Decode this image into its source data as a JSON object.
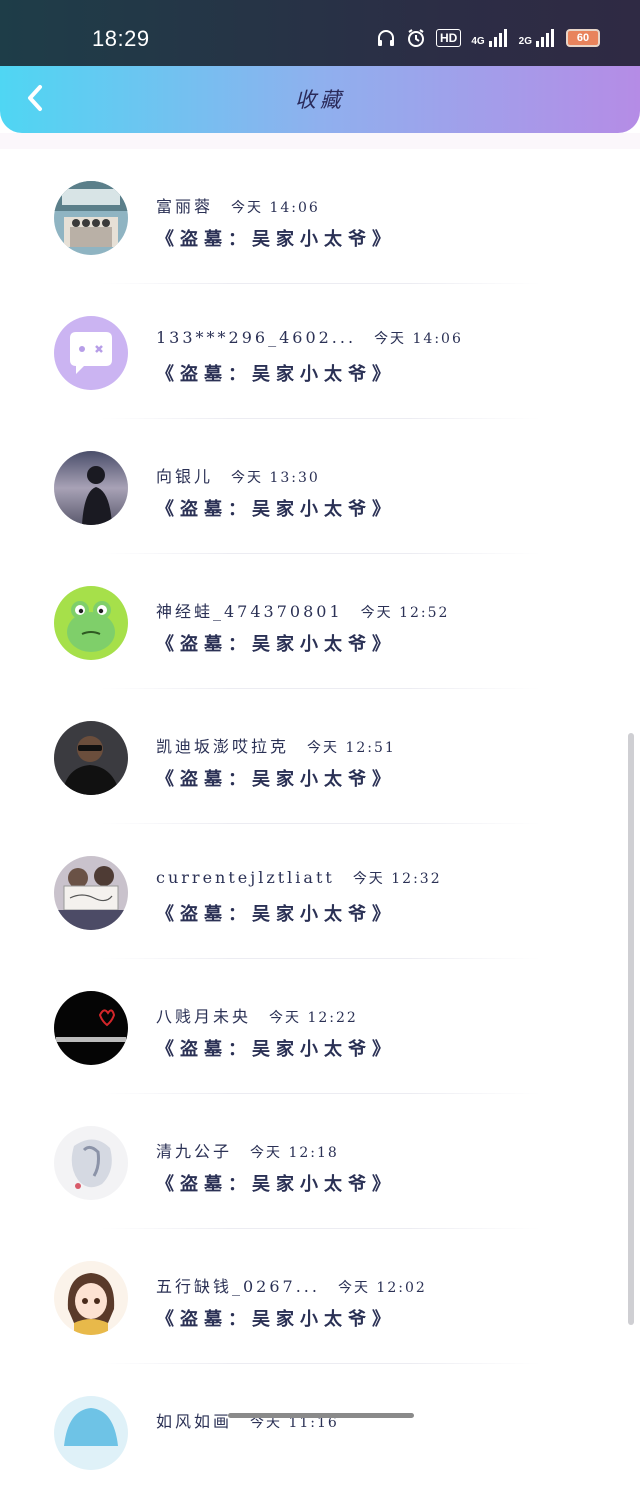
{
  "status_bar": {
    "time": "18:29",
    "network_4g": "4G",
    "network_2g": "2G",
    "hd": "HD",
    "battery": "60",
    "icons": [
      "headphones-icon",
      "alarm-icon",
      "hd-icon",
      "signal-4g-icon",
      "signal-2g-icon",
      "battery-icon"
    ]
  },
  "header": {
    "title": "收藏",
    "back_icon": "chevron-left-icon"
  },
  "items": [
    {
      "name": "富丽蓉",
      "time": "今天 14:06",
      "book": "《盗墓：吴家小太爷》",
      "avatar": "group-photo"
    },
    {
      "name": "133***296_4602...",
      "time": "今天 14:06",
      "book": "《盗墓：吴家小太爷》",
      "avatar": "default-chat-avatar"
    },
    {
      "name": "向银儿",
      "time": "今天 13:30",
      "book": "《盗墓：吴家小太爷》",
      "avatar": "sunset-silhouette"
    },
    {
      "name": "神经蛙_474370801",
      "time": "今天 12:52",
      "book": "《盗墓：吴家小太爷》",
      "avatar": "green-frog"
    },
    {
      "name": "凯迪坂澎哎拉克",
      "time": "今天 12:51",
      "book": "《盗墓：吴家小太爷》",
      "avatar": "man-sunglasses"
    },
    {
      "name": "currentejlztliatt",
      "time": "今天 12:32",
      "book": "《盗墓：吴家小太爷》",
      "avatar": "couple-sign"
    },
    {
      "name": "八贱月未央",
      "time": "今天 12:22",
      "book": "《盗墓：吴家小太爷》",
      "avatar": "black-heart"
    },
    {
      "name": "清九公子",
      "time": "今天 12:18",
      "book": "《盗墓：吴家小太爷》",
      "avatar": "ink-painting"
    },
    {
      "name": "五行缺钱_0267...",
      "time": "今天 12:02",
      "book": "《盗墓：吴家小太爷》",
      "avatar": "anime-girl"
    },
    {
      "name": "如风如画",
      "time": "今天 11:16",
      "book": "",
      "avatar": "blue-anime"
    }
  ]
}
